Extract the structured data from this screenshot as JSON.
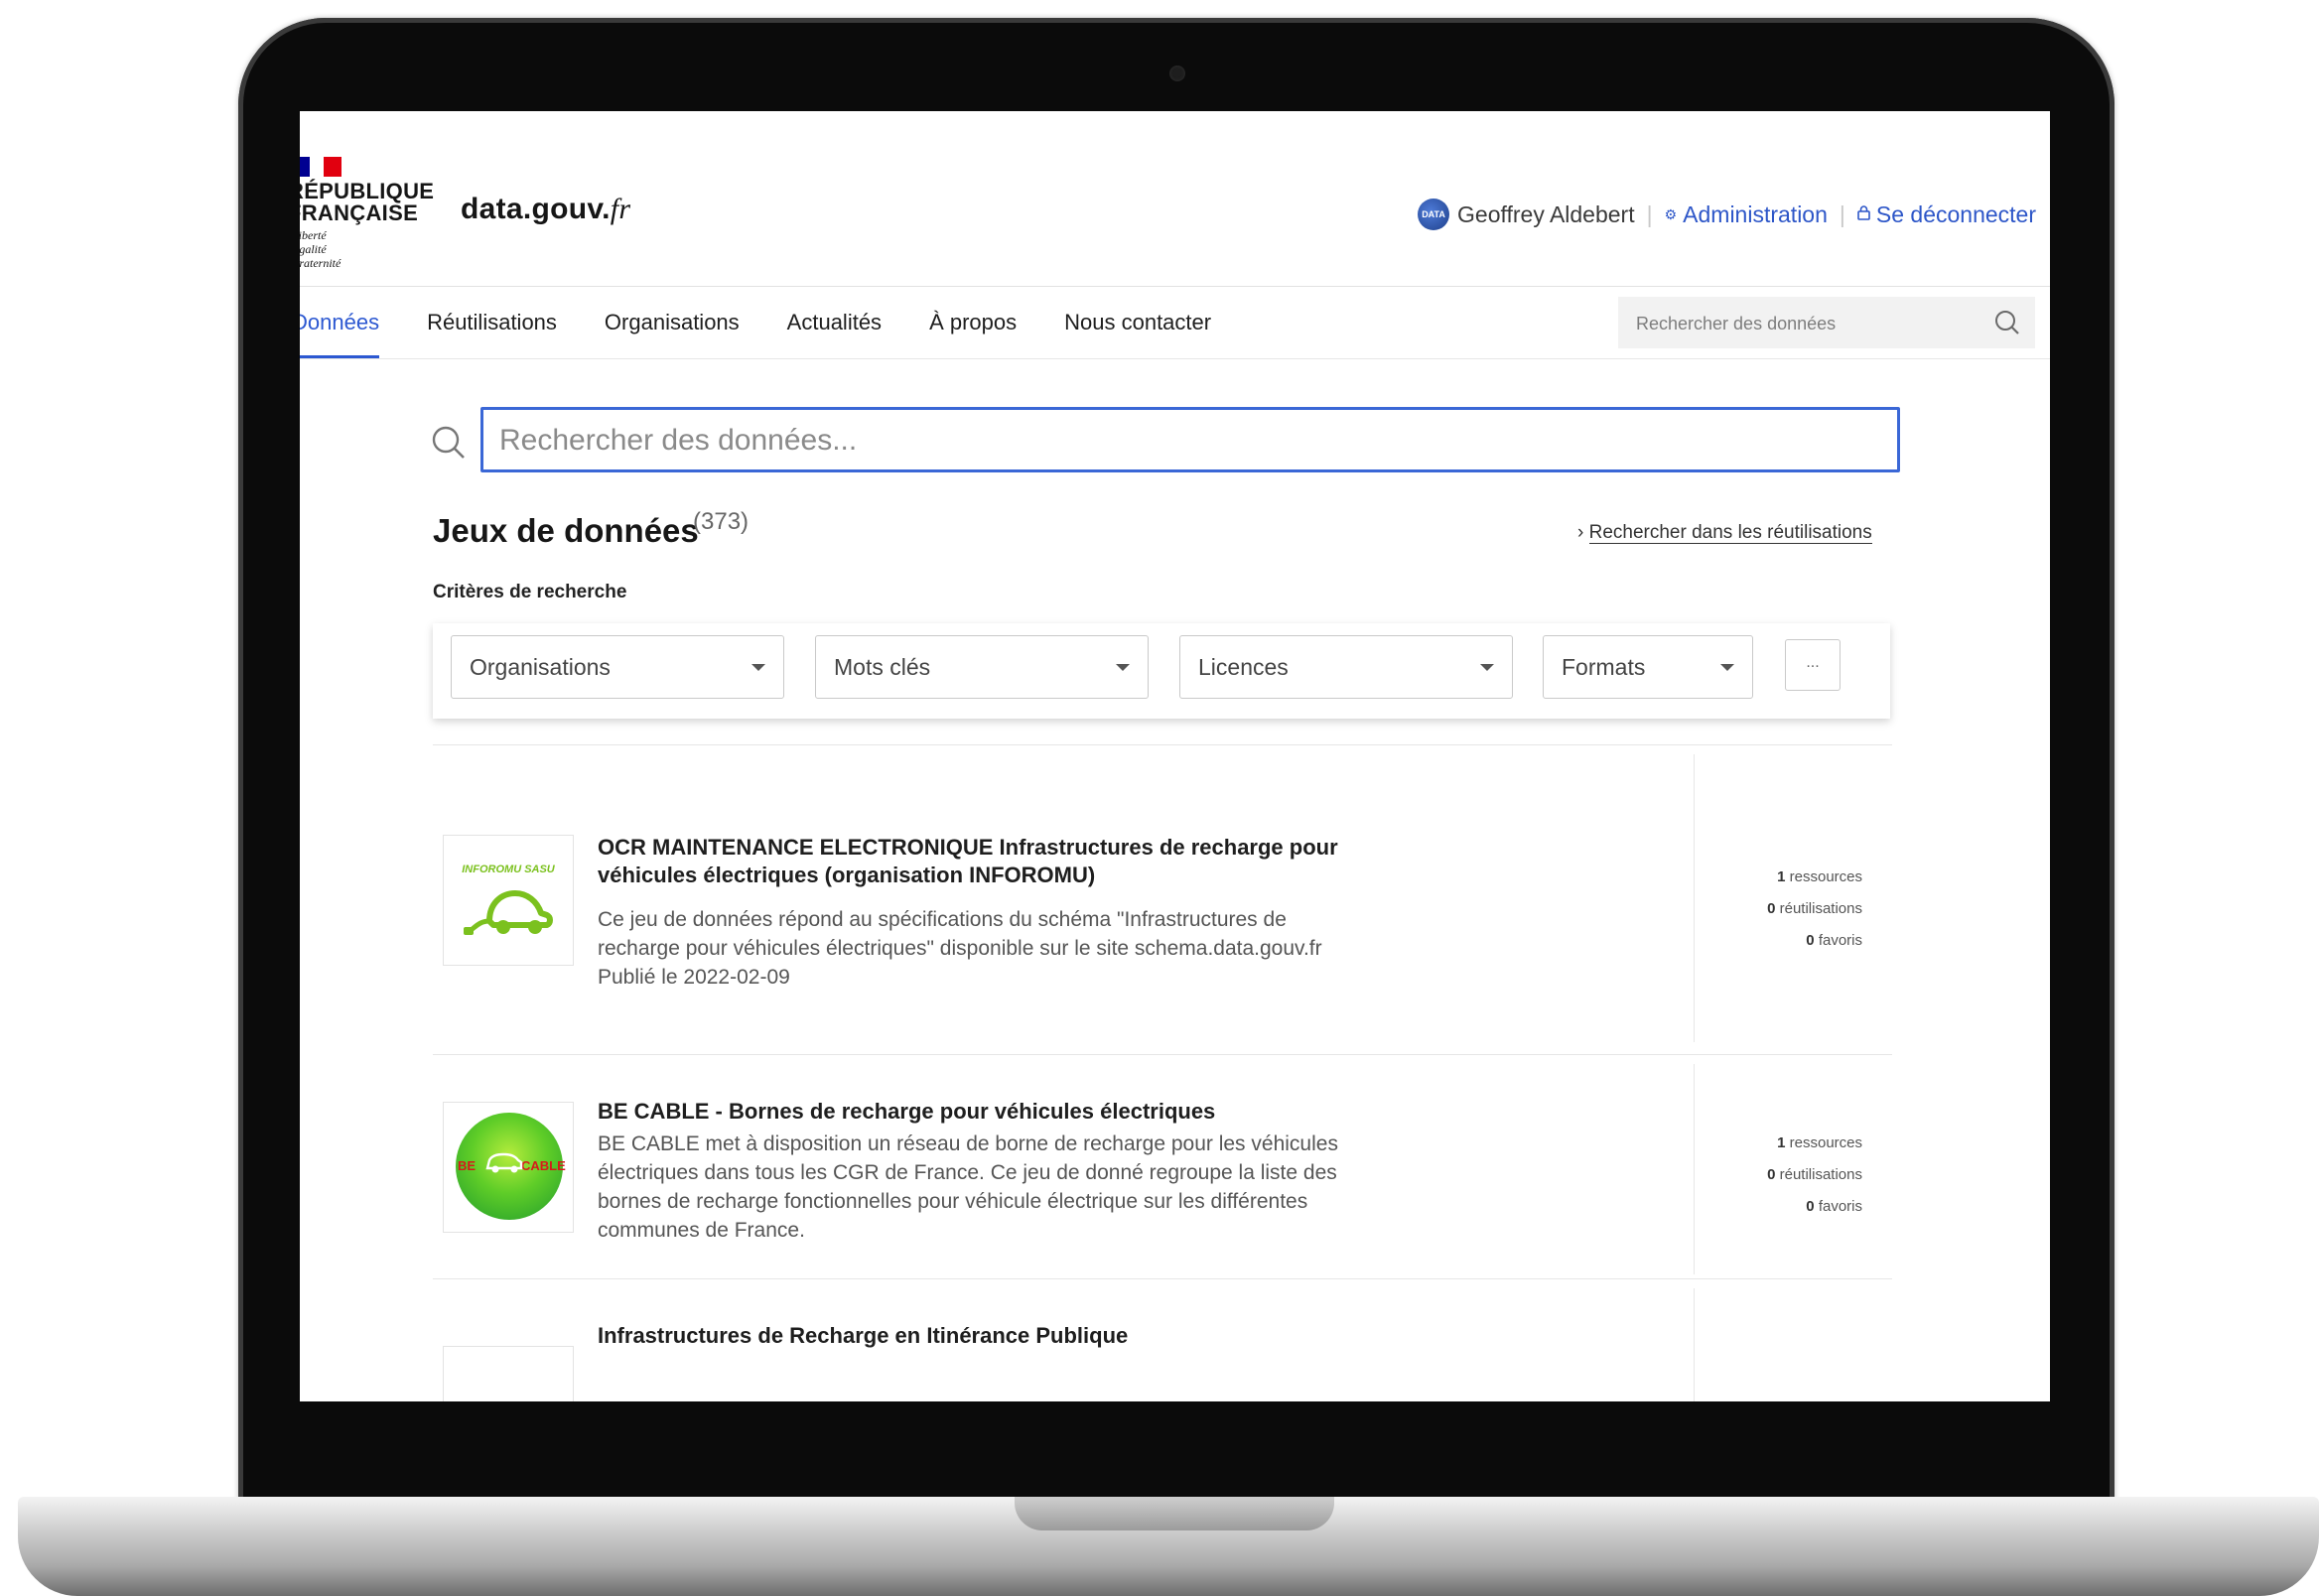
{
  "header": {
    "republic_name": "RÉPUBLIQUE\nFRANÇAISE",
    "republic_motto": "Liberté\nÉgalité\nFraternité",
    "site_name": "data.gouv.",
    "site_tld": "fr",
    "avatar_text": "DATA",
    "user_name": "Geoffrey Aldebert",
    "admin_label": "Administration",
    "logout_label": "Se déconnecter"
  },
  "nav": {
    "items": [
      {
        "label": "Données",
        "active": true
      },
      {
        "label": "Réutilisations"
      },
      {
        "label": "Organisations"
      },
      {
        "label": "Actualités"
      },
      {
        "label": "À propos"
      },
      {
        "label": "Nous contacter"
      }
    ],
    "search_placeholder": "Rechercher des données"
  },
  "search": {
    "placeholder": "Rechercher des données...",
    "value": ""
  },
  "results_header": {
    "title": "Jeux de données",
    "count": "373",
    "reuse_link": "Rechercher dans les réutilisations",
    "criteria_label": "Critères de recherche"
  },
  "filters": {
    "organisations": "Organisations",
    "keywords": "Mots clés",
    "licences": "Licences",
    "formats": "Formats",
    "more": "..."
  },
  "results": [
    {
      "title": "OCR MAINTENANCE ELECTRONIQUE Infrastructures de recharge pour véhicules électriques (organisation INFOROMU)",
      "description": "Ce jeu de données répond au spécifications du schéma \"Infrastructures de recharge pour véhicules électriques\" disponible sur le site schema.data.gouv.fr Publié le 2022-02-09",
      "logo_text": "INFOROMU SASU",
      "logo_icon": "electric-car-plug-icon",
      "resources": "1",
      "resources_label": "ressources",
      "reuses": "0",
      "reuses_label": "réutilisations",
      "favorites": "0",
      "favorites_label": "favoris"
    },
    {
      "title": "BE CABLE - Bornes de recharge pour véhicules électriques",
      "description": "BE CABLE met à disposition un réseau de borne de recharge pour les véhicules électriques dans tous les CGR de France. Ce jeu de donné regroupe la liste des bornes de recharge fonctionnelles pour véhicule électrique sur les différentes communes de France.",
      "logo_text_left": "BE",
      "logo_text_right": "CABLE",
      "logo_icon": "car-icon",
      "resources": "1",
      "resources_label": "ressources",
      "reuses": "0",
      "reuses_label": "réutilisations",
      "favorites": "0",
      "favorites_label": "favoris"
    },
    {
      "title": "Infrastructures de Recharge en Itinérance Publique"
    }
  ],
  "colors": {
    "accent_blue": "#2c58d1",
    "marianne_blue": "#000091",
    "marianne_red": "#e1000f",
    "inforomu_green": "#7bc11e"
  }
}
